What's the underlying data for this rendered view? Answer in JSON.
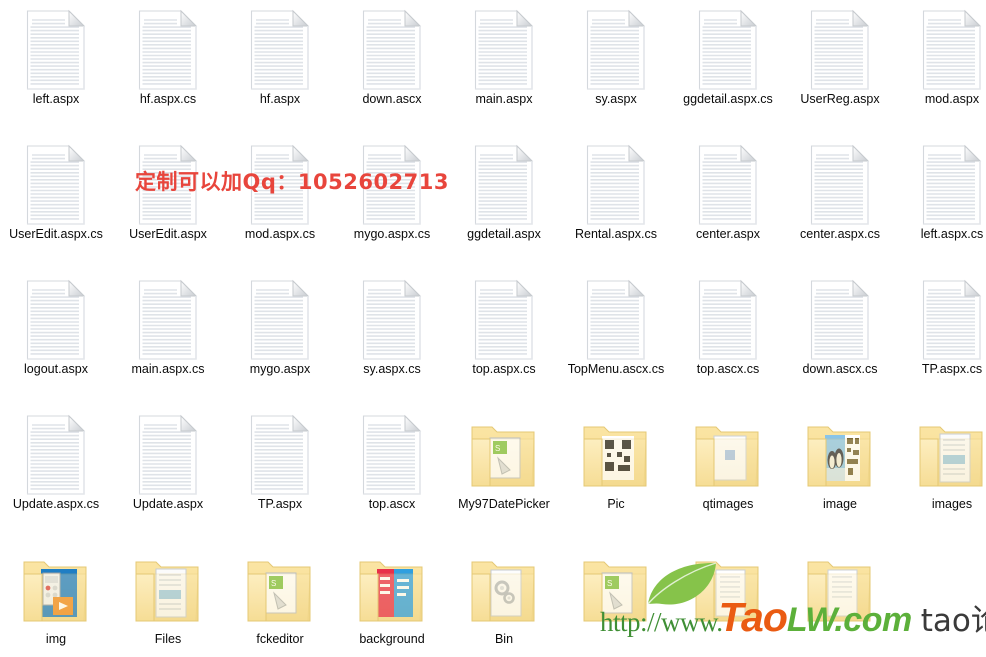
{
  "window": {
    "view_mode": "medium-icons",
    "background_color": "#ffffff",
    "columns": 9,
    "rows": 5
  },
  "items": [
    {
      "name": "left.aspx",
      "type": "file",
      "row": 0,
      "col": 0
    },
    {
      "name": "hf.aspx.cs",
      "type": "file",
      "row": 0,
      "col": 1
    },
    {
      "name": "hf.aspx",
      "type": "file",
      "row": 0,
      "col": 2
    },
    {
      "name": "down.ascx",
      "type": "file",
      "row": 0,
      "col": 3
    },
    {
      "name": "main.aspx",
      "type": "file",
      "row": 0,
      "col": 4
    },
    {
      "name": "sy.aspx",
      "type": "file",
      "row": 0,
      "col": 5
    },
    {
      "name": "ggdetail.aspx.cs",
      "type": "file",
      "row": 0,
      "col": 6
    },
    {
      "name": "UserReg.aspx",
      "type": "file",
      "row": 0,
      "col": 7
    },
    {
      "name": "mod.aspx",
      "type": "file",
      "row": 0,
      "col": 8
    },
    {
      "name": "UserEdit.aspx.cs",
      "type": "file",
      "row": 1,
      "col": 0
    },
    {
      "name": "UserEdit.aspx",
      "type": "file",
      "row": 1,
      "col": 1
    },
    {
      "name": "mod.aspx.cs",
      "type": "file",
      "row": 1,
      "col": 2
    },
    {
      "name": "mygo.aspx.cs",
      "type": "file",
      "row": 1,
      "col": 3
    },
    {
      "name": "ggdetail.aspx",
      "type": "file",
      "row": 1,
      "col": 4
    },
    {
      "name": "Rental.aspx.cs",
      "type": "file",
      "row": 1,
      "col": 5
    },
    {
      "name": "center.aspx",
      "type": "file",
      "row": 1,
      "col": 6
    },
    {
      "name": "center.aspx.cs",
      "type": "file",
      "row": 1,
      "col": 7
    },
    {
      "name": "left.aspx.cs",
      "type": "file",
      "row": 1,
      "col": 8
    },
    {
      "name": "logout.aspx",
      "type": "file",
      "row": 2,
      "col": 0
    },
    {
      "name": "main.aspx.cs",
      "type": "file",
      "row": 2,
      "col": 1
    },
    {
      "name": "mygo.aspx",
      "type": "file",
      "row": 2,
      "col": 2
    },
    {
      "name": "sy.aspx.cs",
      "type": "file",
      "row": 2,
      "col": 3
    },
    {
      "name": "top.aspx.cs",
      "type": "file",
      "row": 2,
      "col": 4
    },
    {
      "name": "TopMenu.ascx.cs",
      "type": "file",
      "row": 2,
      "col": 5
    },
    {
      "name": "top.ascx.cs",
      "type": "file",
      "row": 2,
      "col": 6
    },
    {
      "name": "down.ascx.cs",
      "type": "file",
      "row": 2,
      "col": 7
    },
    {
      "name": "TP.aspx.cs",
      "type": "file",
      "row": 2,
      "col": 8
    },
    {
      "name": "Update.aspx.cs",
      "type": "file",
      "row": 3,
      "col": 0
    },
    {
      "name": "Update.aspx",
      "type": "file",
      "row": 3,
      "col": 1
    },
    {
      "name": "TP.aspx",
      "type": "file",
      "row": 3,
      "col": 2
    },
    {
      "name": "top.ascx",
      "type": "file",
      "row": 3,
      "col": 3
    },
    {
      "name": "My97DatePicker",
      "type": "folder",
      "row": 3,
      "col": 4,
      "thumb": "doc-green"
    },
    {
      "name": "Pic",
      "type": "folder",
      "row": 3,
      "col": 5,
      "thumb": "qr-dark"
    },
    {
      "name": "qtimages",
      "type": "folder",
      "row": 3,
      "col": 6,
      "thumb": "blank-page"
    },
    {
      "name": "image",
      "type": "folder",
      "row": 3,
      "col": 7,
      "thumb": "penguins-qr"
    },
    {
      "name": "images",
      "type": "folder",
      "row": 3,
      "col": 8,
      "thumb": "stack-photos"
    },
    {
      "name": "img",
      "type": "folder",
      "row": 4,
      "col": 0,
      "thumb": "blue-app"
    },
    {
      "name": "Files",
      "type": "folder",
      "row": 4,
      "col": 1,
      "thumb": "stack-photos"
    },
    {
      "name": "fckeditor",
      "type": "folder",
      "row": 4,
      "col": 2,
      "thumb": "doc-green"
    },
    {
      "name": "background",
      "type": "folder",
      "row": 4,
      "col": 3,
      "thumb": "red-blue-poster"
    },
    {
      "name": "Bin",
      "type": "folder",
      "row": 4,
      "col": 4,
      "thumb": "gears-page"
    },
    {
      "name": "",
      "type": "folder",
      "row": 4,
      "col": 5,
      "thumb": "doc-green"
    },
    {
      "name": "",
      "type": "folder",
      "row": 4,
      "col": 6,
      "thumb": "plain-pages"
    },
    {
      "name": "",
      "type": "folder",
      "row": 4,
      "col": 7,
      "thumb": "plain-pages"
    }
  ],
  "watermarks": {
    "red_text": "定制可以加Qq：1052602713",
    "red_color": "#e8453c",
    "site_url_prefix": "http://www.",
    "site_name_orange": "Tao",
    "site_name_green": "LW.com",
    "site_tagline": "tao论文",
    "url_color": "#3f8f35",
    "orange_color": "#ea5b12",
    "green_color": "#5cb03a",
    "tagline_color": "#3a3a3a"
  }
}
